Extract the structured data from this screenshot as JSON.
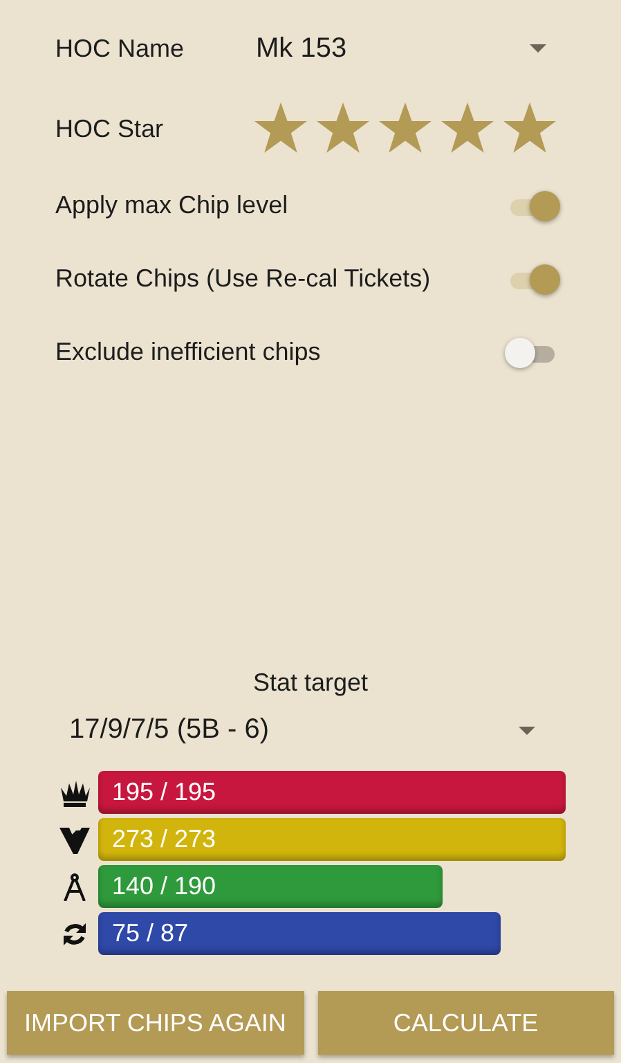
{
  "hoc_name": {
    "label": "HOC Name",
    "value": "Mk 153"
  },
  "hoc_star": {
    "label": "HOC Star",
    "stars": 5
  },
  "options": [
    {
      "label": "Apply max Chip level",
      "on": true
    },
    {
      "label": "Rotate Chips (Use Re-cal Tickets)",
      "on": true
    },
    {
      "label": "Exclude inefficient chips",
      "on": false
    }
  ],
  "stat_target": {
    "label": "Stat target",
    "value": "17/9/7/5 (5B - 6)"
  },
  "stats": [
    {
      "kind": "damage",
      "reading": "195 / 195",
      "color": "#c8173e"
    },
    {
      "kind": "breach",
      "reading": "273 / 273",
      "color": "#d2b50c"
    },
    {
      "kind": "precision",
      "reading": "140 / 190",
      "color": "#2f9a3c"
    },
    {
      "kind": "reload",
      "reading": "75 / 87",
      "color": "#2f49a8"
    }
  ],
  "buttons": [
    "IMPORT CHIPS AGAIN",
    "CALCULATE"
  ]
}
